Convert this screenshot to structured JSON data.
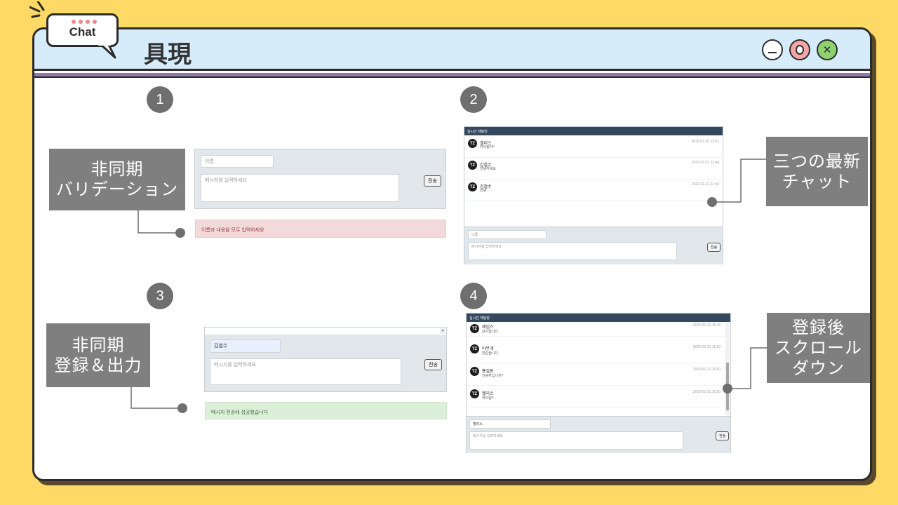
{
  "logo": {
    "text": "Chat"
  },
  "title": "具現",
  "steps": [
    "1",
    "2",
    "3",
    "4"
  ],
  "callouts": {
    "c1": [
      "非同期",
      "バリデーション"
    ],
    "c2": [
      "三つの最新",
      "チャット"
    ],
    "c3": [
      "非同期",
      "登録＆出力"
    ],
    "c4": [
      "登録後",
      "スクロール",
      "ダウン"
    ]
  },
  "panel1": {
    "name_placeholder": "이름",
    "message_placeholder": "메시지를 입력하세요",
    "send_label": "전송",
    "alert": "이름과 내용을 모두 입력하세요"
  },
  "panel2": {
    "header": "실시간 채팅방",
    "avatar": "TZ",
    "messages": [
      {
        "name": "앨리스",
        "text": "하이링!!!!!",
        "time": "2022-01-20 12:51"
      },
      {
        "name": "김철수",
        "text": "안녕하세요",
        "time": "2022-01-21 11:44"
      },
      {
        "name": "김철수",
        "text": "안녕",
        "time": "2022-01-21 11:44"
      }
    ],
    "name_placeholder": "이름",
    "message_placeholder": "메시지를 입력하세요",
    "send_label": "전송"
  },
  "panel3": {
    "name_value": "김철수",
    "message_placeholder": "메시지를 입력하세요",
    "send_label": "전송",
    "alert": "메시지 전송에 성공했습니다"
  },
  "panel4": {
    "header": "실시간 채팅방",
    "avatar": "TZ",
    "messages": [
      {
        "name": "제임스",
        "text": "감사합니다",
        "time": "2022-01-21 11:49"
      },
      {
        "name": "아무개",
        "text": "반갑습니다",
        "time": "2022-01-21 11:50"
      },
      {
        "name": "홍길동",
        "text": "안녕하십니까?",
        "time": "2022-01-21 11:50"
      },
      {
        "name": "앨리스",
        "text": "하이링!!",
        "time": "2022-01-21 11:50"
      }
    ],
    "name_value": "앨리스",
    "message_placeholder": "메시지를 입력하세요",
    "send_label": "전송"
  },
  "colors": {
    "background": "#ffd966",
    "titlebar": "#d6ecfb",
    "stripe": "#8e7ba8",
    "callout": "#7f7f7f",
    "step": "#6f6f6f",
    "chat_header": "#34495e"
  },
  "icons": {
    "minimize": "minimize-icon",
    "maximize": "maximize-icon",
    "close": "close-icon",
    "avatar": "avatar-icon"
  }
}
